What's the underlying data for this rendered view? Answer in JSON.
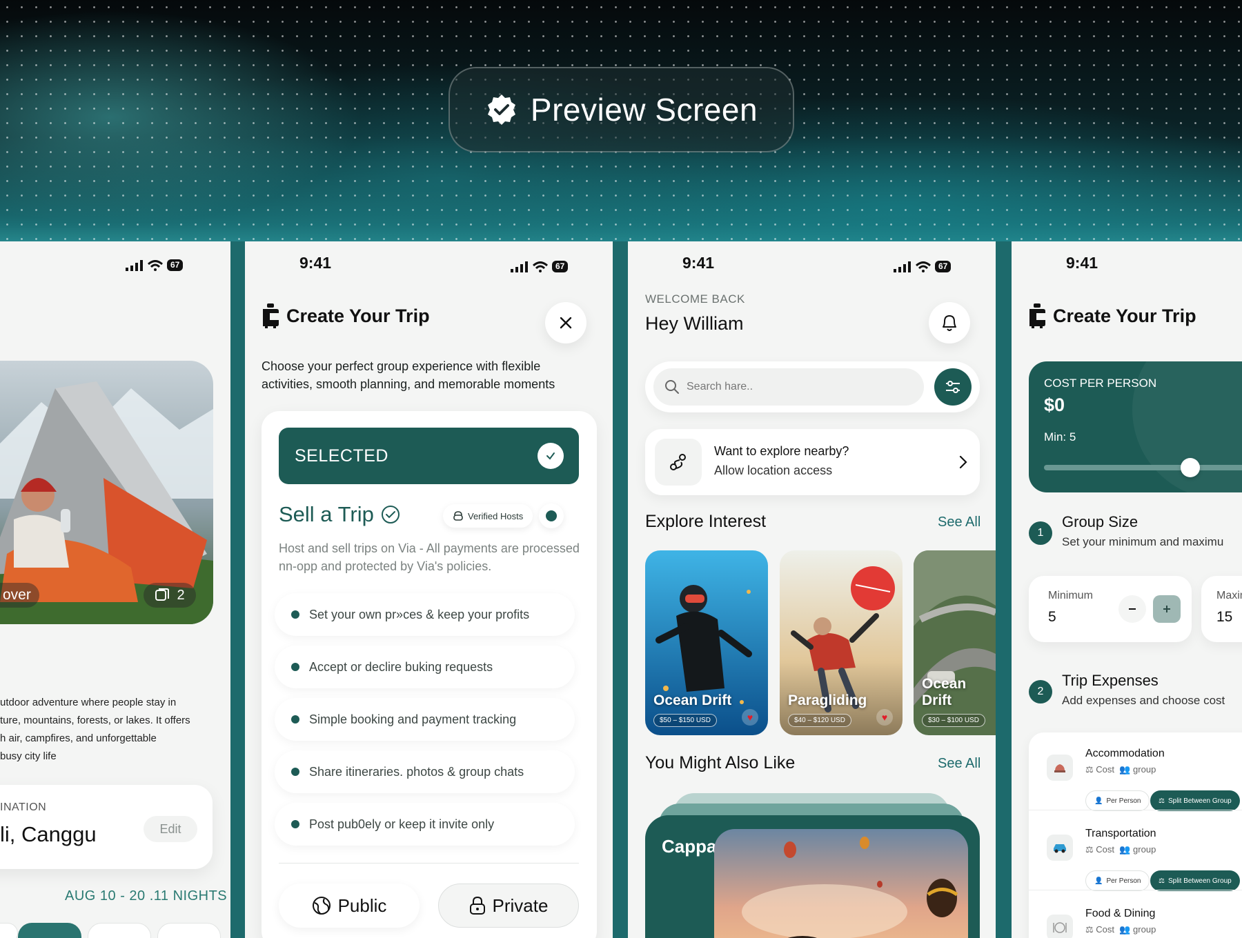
{
  "hero": {
    "title": "Preview Screen"
  },
  "status": {
    "time": "9:41",
    "battery": "67"
  },
  "phone1": {
    "image_caption": "over",
    "image_count": "2",
    "description_lines": [
      "utdoor adventure where people stay in",
      "ture, mountains, forests, or lakes. It offers",
      "h air, campfires, and unforgettable",
      "busy city life"
    ],
    "destination_label": "INATION",
    "destination_value": "li, Canggu",
    "edit_label": "Edit",
    "dates": "AUG 10 - 20 .11 NIGHTS"
  },
  "phone2": {
    "title": "Create Your Trip",
    "intro": "Choose your perfect group experience with flexible activities, smooth planning, and memorable moments",
    "selected_label": "SELECTED",
    "option_title": "Sell a Trip",
    "verified_label": "Verified Hosts",
    "option_desc": "Host and sell trips on Via - All payments are processed nn-opp and protected by Via's policies.",
    "features": [
      "Set your own pr»ces & keep your profits",
      "Accept or declire buking requests",
      "Simple booking and payment tracking",
      "Share itineraries. photos & group chats",
      "Post pub0ely or keep it invite only"
    ],
    "public_label": "Public",
    "private_label": "Private"
  },
  "phone3": {
    "welcome": "WELCOME BACK",
    "greeting": "Hey William",
    "search_placeholder": "Search hare..",
    "nearby_title": "Want to explore nearby?",
    "nearby_sub": "Allow location access",
    "explore_title": "Explore Interest",
    "see_all": "See All",
    "tiles": [
      {
        "name": "Ocean Drift",
        "price": "$50 – $150 USD"
      },
      {
        "name": "Paragliding",
        "price": "$40 – $120 USD"
      },
      {
        "name": "Ocean Drift",
        "price": "$30 – $100 USD"
      }
    ],
    "also_title": "You Might Also Like",
    "also_see_all": "See All",
    "featured": "Cappadocia"
  },
  "phone4": {
    "title": "Create Your Trip",
    "cost_label": "COST PER PERSON",
    "cost_value": "$0",
    "min_label": "Min: 5",
    "slider_fraction": 0.78,
    "step1": "1",
    "group_title": "Group Size",
    "group_sub": "Set your minimum and maximu",
    "minimum_label": "Minimum",
    "minimum_value": "5",
    "maximum_label": "Maxim",
    "maximum_value": "15",
    "step2": "2",
    "expenses_title": "Trip Expenses",
    "expenses_sub": "Add expenses and choose cost",
    "expenses": [
      {
        "name": "Accommodation",
        "cost": "Cost",
        "group": "group",
        "per_person": "Per Person",
        "split": "Split Between Group"
      },
      {
        "name": "Transportation",
        "cost": "Cost",
        "group": "group",
        "per_person": "Per Person",
        "split": "Split Between Group"
      },
      {
        "name": "Food & Dining",
        "cost": "Cost",
        "group": "group"
      }
    ]
  },
  "colors": {
    "accent": "#1d5b55",
    "teal": "#1d6a6c"
  }
}
